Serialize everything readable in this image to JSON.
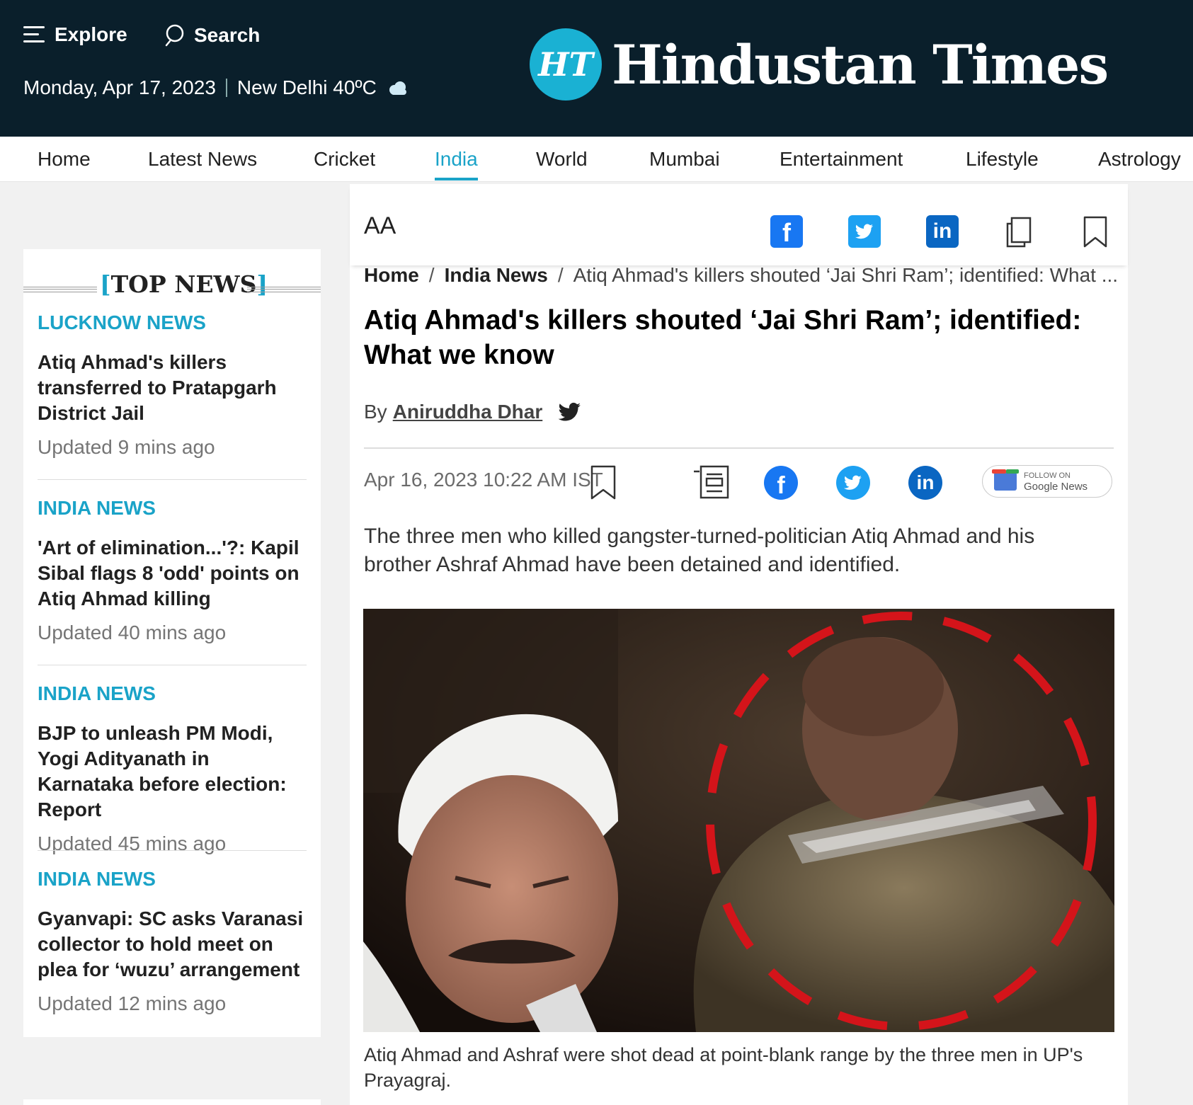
{
  "header": {
    "explore_label": "Explore",
    "search_label": "Search",
    "date": "Monday, Apr 17, 2023",
    "weather": "New Delhi 40ºC",
    "logo_mark": "HT",
    "logo_text": "Hindustan Times"
  },
  "nav": {
    "items": [
      {
        "label": "Home"
      },
      {
        "label": "Latest News"
      },
      {
        "label": "Cricket"
      },
      {
        "label": "India"
      },
      {
        "label": "World"
      },
      {
        "label": "Mumbai"
      },
      {
        "label": "Entertainment"
      },
      {
        "label": "Lifestyle"
      },
      {
        "label": "Astrology"
      }
    ],
    "active": "India"
  },
  "sidebar": {
    "heading": "TOP NEWS",
    "items": [
      {
        "category": "LUCKNOW NEWS",
        "title": "Atiq Ahmad's killers transferred to Pratapgarh District Jail",
        "time": "Updated 9 mins ago"
      },
      {
        "category": "INDIA NEWS",
        "title": "'Art of elimination...'?: Kapil Sibal flags 8 'odd' points on Atiq Ahmad killing",
        "time": "Updated 40 mins ago"
      },
      {
        "category": "INDIA NEWS",
        "title": "BJP to unleash PM Modi, Yogi Adityanath in Karnataka before election: Report",
        "time": "Updated 45 mins ago"
      },
      {
        "category": "INDIA NEWS",
        "title": "Gyanvapi: SC asks Varanasi collector to hold meet on plea for ‘wuzu’ arrangement",
        "time": "Updated 12 mins ago"
      }
    ]
  },
  "article": {
    "font_size_label": "AA",
    "breadcrumbs": [
      "Home",
      "India News",
      "Atiq Ahmad's killers shouted ‘Jai Shri Ram’; identified: What ..."
    ],
    "headline": "Atiq Ahmad's killers shouted ‘Jai Shri Ram’; identified: What we know",
    "by_label": "By",
    "author": "Aniruddha Dhar",
    "date": "Apr 16, 2023 10:22 AM IST",
    "google_news": {
      "follow": "FOLLOW ON",
      "google": "Google",
      "news": "News"
    },
    "summary": "The three men who killed gangster-turned-politician Atiq Ahmad and his brother Ashraf Ahmad have been detained and identified.",
    "caption": "Atiq Ahmad and Ashraf were shot dead at point-blank range by the three men in UP's Prayagraj."
  },
  "colors": {
    "header_bg": "#0a1f2b",
    "accent": "#1aa3c8",
    "facebook": "#1877f2",
    "twitter": "#1da1f2",
    "linkedin": "#0a66c2"
  }
}
